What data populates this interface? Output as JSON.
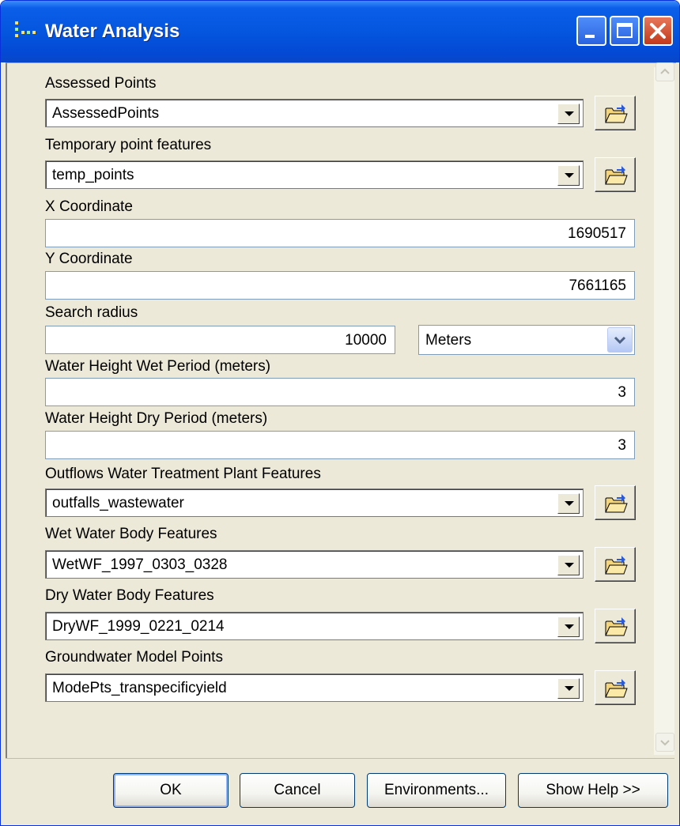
{
  "window": {
    "title": "Water Analysis"
  },
  "fields": {
    "assessed_points": {
      "label": "Assessed Points",
      "value": "AssessedPoints"
    },
    "temp_points": {
      "label": "Temporary point features",
      "value": "temp_points"
    },
    "x_coordinate": {
      "label": "X Coordinate",
      "value": "1690517"
    },
    "y_coordinate": {
      "label": "Y Coordinate",
      "value": "7661165"
    },
    "search_radius": {
      "label": "Search radius",
      "value": "10000",
      "unit": "Meters"
    },
    "wet_height": {
      "label": "Water Height Wet Period (meters)",
      "value": "3"
    },
    "dry_height": {
      "label": "Water Height Dry Period (meters)",
      "value": "3"
    },
    "outflows": {
      "label": "Outflows Water Treatment Plant Features",
      "value": "outfalls_wastewater"
    },
    "wet_water_body": {
      "label": "Wet Water Body Features",
      "value": "WetWF_1997_0303_0328"
    },
    "dry_water_body": {
      "label": "Dry Water Body Features",
      "value": "DryWF_1999_0221_0214"
    },
    "groundwater": {
      "label": "Groundwater Model Points",
      "value": "ModePts_transpecificyield"
    }
  },
  "buttons": {
    "ok": "OK",
    "cancel": "Cancel",
    "environments": "Environments...",
    "show_help": "Show Help >>"
  },
  "icons": {
    "app": "toolbox-dots-icon",
    "browse": "open-folder-icon"
  },
  "colors": {
    "titlebar": "#0556df",
    "dialog_bg": "#ece9d8",
    "close_button": "#c2391a"
  }
}
